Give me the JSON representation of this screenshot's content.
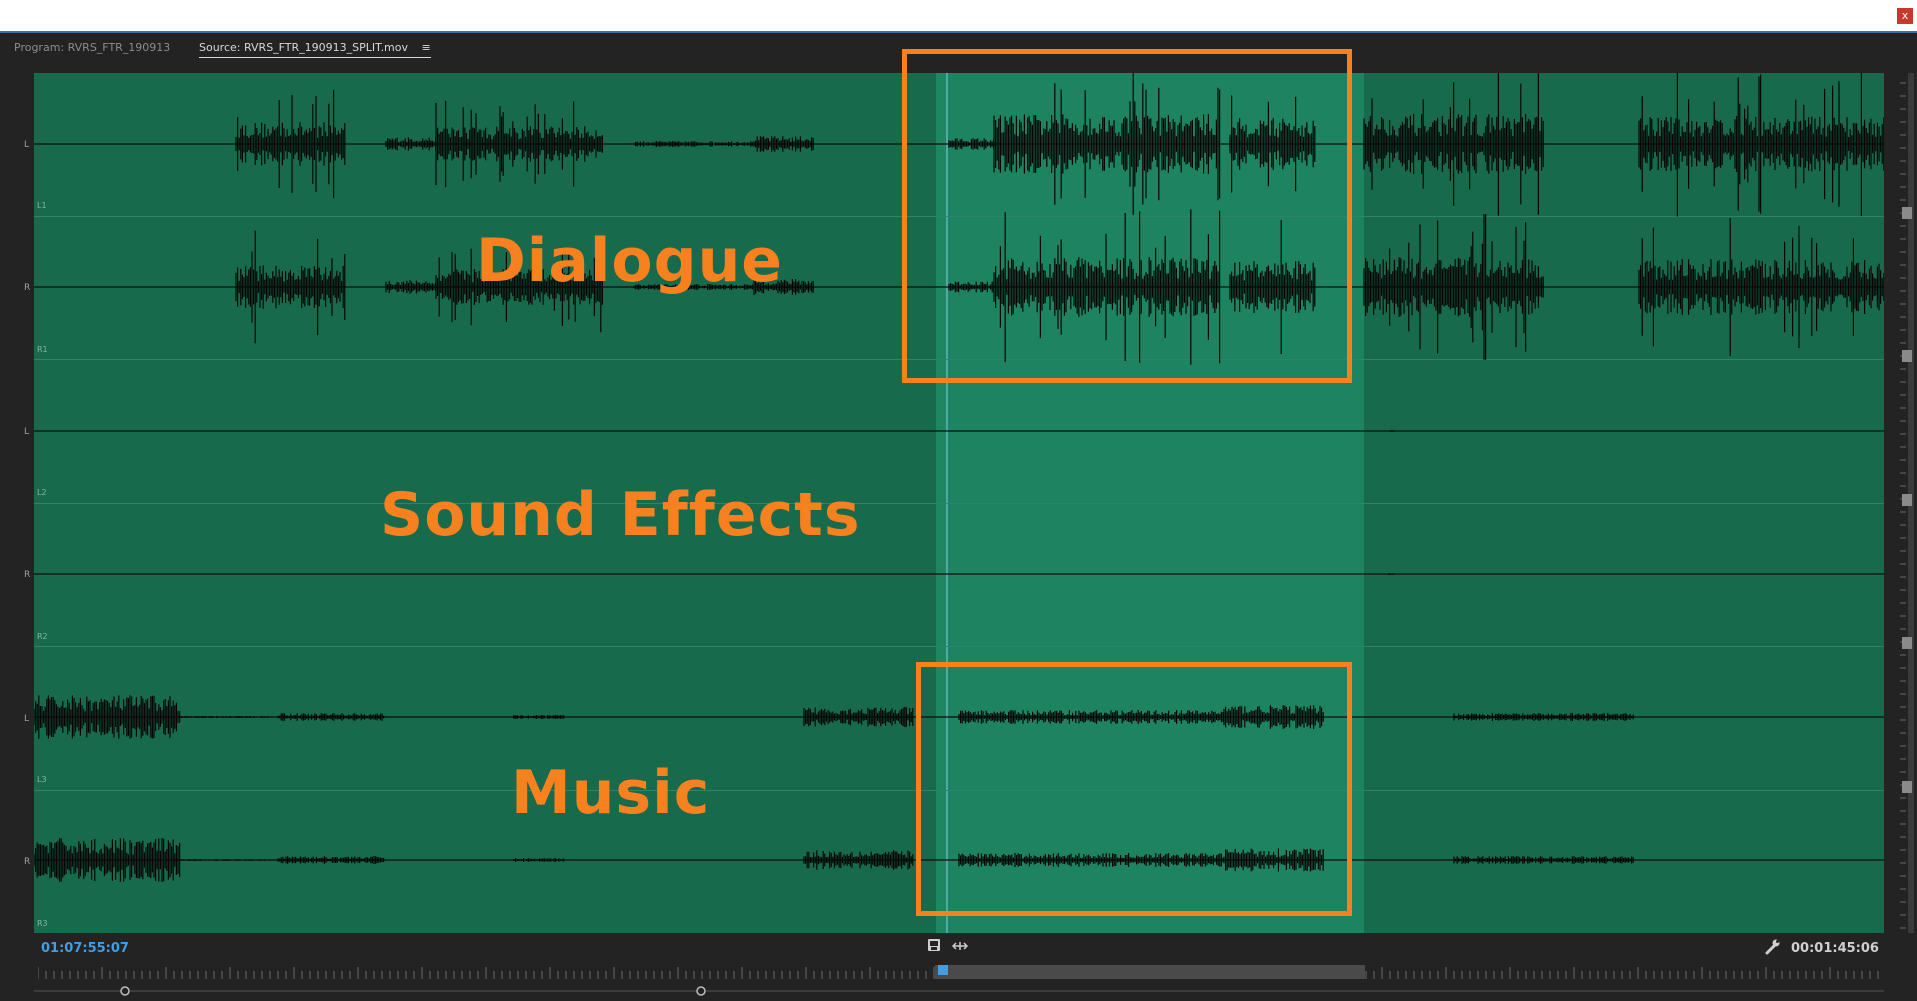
{
  "window": {
    "close_label": "x"
  },
  "tabs": [
    {
      "label": "Program: RVRS_FTR_190913"
    },
    {
      "label": "Source: RVRS_FTR_190913_SPLIT.mov",
      "menu_icon": "hamburger-menu-icon"
    }
  ],
  "channel_labels": [
    "L",
    "R",
    "L",
    "R",
    "L",
    "R"
  ],
  "track_codes": [
    "L1",
    "R1",
    "L2",
    "R2",
    "L3",
    "R3"
  ],
  "annotations": {
    "dialogue": "Dialogue",
    "sound_effects": "Sound Effects",
    "music": "Music"
  },
  "timecode": {
    "current": "01:07:55:07",
    "duration": "00:01:45:06"
  },
  "icons": {
    "export_frame": "camera-icon",
    "fit": "fit-arrows-icon",
    "settings": "wrench-icon"
  },
  "colors": {
    "waveform_bg": "#176a4c",
    "in_out_range": "#1d8360",
    "annotation": "#f7811f",
    "timecode_active": "#3f9ee6"
  }
}
